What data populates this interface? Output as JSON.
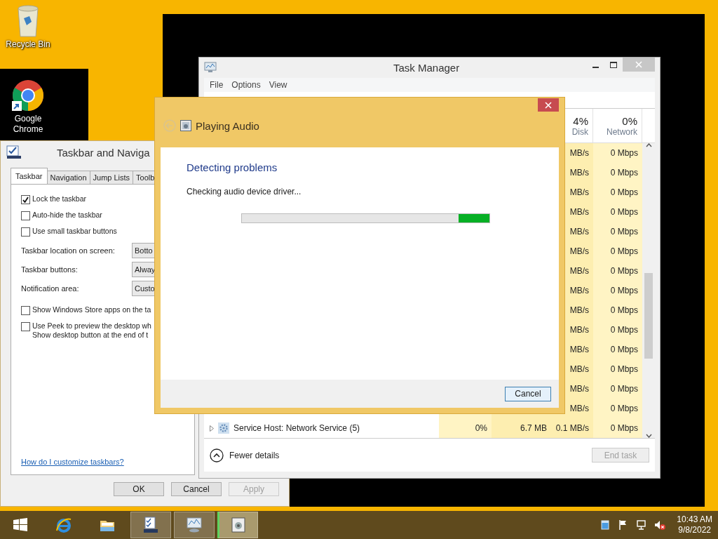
{
  "desktop": {
    "icons": [
      {
        "label": "Recycle Bin",
        "kind": "recycle"
      },
      {
        "label": "Google Chrome",
        "kind": "chrome"
      }
    ]
  },
  "taskbar_properties": {
    "title": "Taskbar and Naviga",
    "tabs": [
      {
        "label": "Taskbar",
        "selected": true
      },
      {
        "label": "Navigation",
        "selected": false
      },
      {
        "label": "Jump Lists",
        "selected": false
      },
      {
        "label": "Toolb",
        "selected": false
      }
    ],
    "options": [
      {
        "kind": "checkbox",
        "lines": [
          "Lock the taskbar"
        ],
        "checked": true
      },
      {
        "kind": "checkbox",
        "lines": [
          "Auto-hide the taskbar"
        ],
        "checked": false
      },
      {
        "kind": "checkbox",
        "lines": [
          "Use small taskbar buttons"
        ],
        "checked": false
      },
      {
        "kind": "dropdown",
        "label": "Taskbar location on screen:",
        "value": "Botto"
      },
      {
        "kind": "dropdown",
        "label": "Taskbar buttons:",
        "value": "Alway"
      },
      {
        "kind": "dropdown",
        "label": "Notification area:",
        "value": "Custo"
      },
      {
        "kind": "checkbox",
        "lines": [
          "Show Windows Store apps on the ta"
        ],
        "checked": false
      },
      {
        "kind": "checkbox",
        "lines": [
          "Use Peek to preview the desktop wh",
          "Show desktop button at the end of t"
        ],
        "checked": false
      }
    ],
    "link": "How do I customize taskbars?",
    "buttons": [
      {
        "label": "OK",
        "disabled": false
      },
      {
        "label": "Cancel",
        "disabled": false
      },
      {
        "label": "Apply",
        "disabled": true
      }
    ]
  },
  "task_manager": {
    "title": "Task Manager",
    "menu": [
      "File",
      "Options",
      "View"
    ],
    "columns": [
      {
        "percent": "4%",
        "label": "Disk"
      },
      {
        "percent": "0%",
        "label": "Network"
      }
    ],
    "rows": [
      {
        "disk": "MB/s",
        "network": "0 Mbps"
      },
      {
        "disk": "MB/s",
        "network": "0 Mbps"
      },
      {
        "disk": "MB/s",
        "network": "0 Mbps"
      },
      {
        "disk": "MB/s",
        "network": "0 Mbps"
      },
      {
        "disk": "MB/s",
        "network": "0 Mbps"
      },
      {
        "disk": "MB/s",
        "network": "0 Mbps"
      },
      {
        "disk": "MB/s",
        "network": "0 Mbps"
      },
      {
        "disk": "MB/s",
        "network": "0 Mbps"
      },
      {
        "disk": "MB/s",
        "network": "0 Mbps"
      },
      {
        "disk": "MB/s",
        "network": "0 Mbps"
      },
      {
        "disk": "MB/s",
        "network": "0 Mbps"
      },
      {
        "disk": "MB/s",
        "network": "0 Mbps"
      },
      {
        "disk": "MB/s",
        "network": "0 Mbps"
      },
      {
        "disk": "MB/s",
        "network": "0 Mbps"
      },
      {
        "name": "Service Host: Network Service (5)",
        "cpu": "0%",
        "memory": "6.7 MB",
        "disk": "0.1 MB/s",
        "network": "0 Mbps"
      }
    ],
    "fewer_details": "Fewer details",
    "end_task": {
      "label": "End task",
      "disabled": true
    }
  },
  "troubleshooter": {
    "title": "Playing Audio",
    "heading": "Detecting problems",
    "status": "Checking audio device driver...",
    "progress": {
      "indeterminate": true
    },
    "cancel": "Cancel"
  },
  "taskbar": {
    "items": [
      {
        "kind": "start",
        "open": false,
        "selected": false
      },
      {
        "kind": "ie",
        "open": false,
        "selected": false
      },
      {
        "kind": "explorer",
        "open": false,
        "selected": false
      },
      {
        "kind": "taskbar-settings",
        "open": true,
        "selected": false
      },
      {
        "kind": "task-manager",
        "open": true,
        "selected": false
      },
      {
        "kind": "troubleshooter",
        "open": true,
        "selected": true
      }
    ],
    "tray": [
      {
        "kind": "action-center"
      },
      {
        "kind": "flag"
      },
      {
        "kind": "network"
      },
      {
        "kind": "speaker-muted"
      }
    ],
    "time": "10:43 AM",
    "date": "9/8/2022"
  }
}
